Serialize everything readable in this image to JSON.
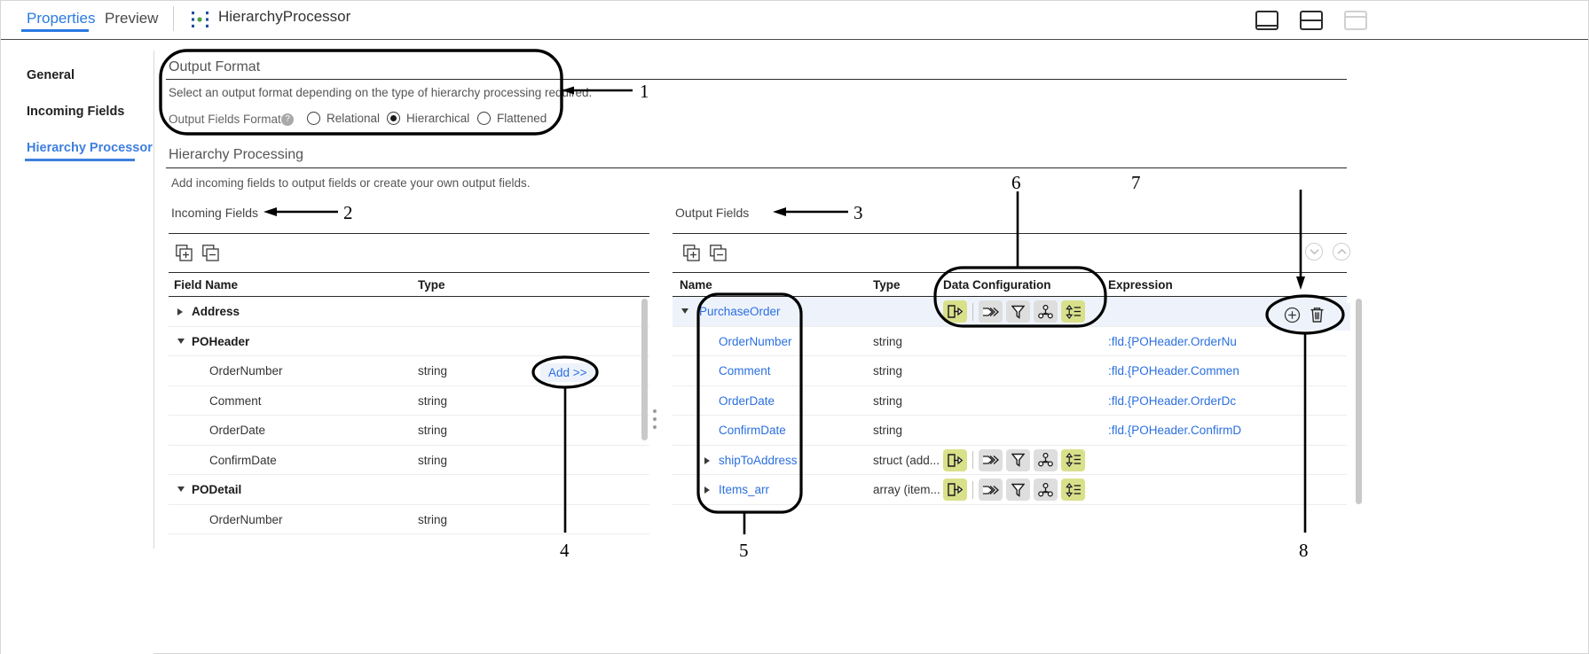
{
  "window": {
    "tabs": [
      {
        "label": "Properties",
        "active": true
      },
      {
        "label": "Preview",
        "active": false
      }
    ],
    "processor_title": "HierarchyProcessor",
    "processor_icon": "hierarchy-processor-icon",
    "layout_buttons": [
      {
        "icon": "layout-bottom-panel-icon",
        "state": "enabled"
      },
      {
        "icon": "layout-split-horizontal-icon",
        "state": "enabled"
      },
      {
        "icon": "layout-single-panel-icon",
        "state": "disabled"
      }
    ]
  },
  "sidebar": {
    "items": [
      {
        "label": "General",
        "active": false
      },
      {
        "label": "Incoming Fields",
        "active": false
      },
      {
        "label": "Hierarchy Processor",
        "active": true
      }
    ]
  },
  "output_format": {
    "title": "Output Format",
    "description": "Select an output format depending on the type of hierarchy processing required.",
    "field_label": "Output Fields Format:",
    "required_marker": "*",
    "help_icon": "help-icon",
    "help_glyph": "?",
    "options": [
      {
        "label": "Relational",
        "selected": false
      },
      {
        "label": "Hierarchical",
        "selected": true
      },
      {
        "label": "Flattened",
        "selected": false
      }
    ]
  },
  "hierarchy_processing": {
    "title": "Hierarchy Processing",
    "description": "Add incoming fields to output fields or create your own output fields."
  },
  "incoming_fields": {
    "panel_label": "Incoming Fields",
    "toolbar": [
      {
        "icon": "expand-all-icon",
        "label": "Expand All"
      },
      {
        "icon": "collapse-all-icon",
        "label": "Collapse All"
      }
    ],
    "columns": [
      "Field Name",
      "Type"
    ],
    "add_button_label": "Add >>",
    "rows": [
      {
        "name": "Address",
        "type": "",
        "level": 0,
        "group": true,
        "caret": "right"
      },
      {
        "name": "POHeader",
        "type": "",
        "level": 0,
        "group": true,
        "caret": "down"
      },
      {
        "name": "OrderNumber",
        "type": "string",
        "level": 1,
        "group": false,
        "caret": "none"
      },
      {
        "name": "Comment",
        "type": "string",
        "level": 1,
        "group": false,
        "caret": "none"
      },
      {
        "name": "OrderDate",
        "type": "string",
        "level": 1,
        "group": false,
        "caret": "none"
      },
      {
        "name": "ConfirmDate",
        "type": "string",
        "level": 1,
        "group": false,
        "caret": "none"
      },
      {
        "name": "PODetail",
        "type": "",
        "level": 0,
        "group": true,
        "caret": "down"
      },
      {
        "name": "OrderNumber",
        "type": "string",
        "level": 1,
        "group": false,
        "caret": "none"
      }
    ]
  },
  "output_fields": {
    "panel_label": "Output Fields",
    "toolbar": [
      {
        "icon": "expand-all-icon",
        "label": "Expand All"
      },
      {
        "icon": "collapse-all-icon",
        "label": "Collapse All"
      }
    ],
    "sort_buttons": [
      {
        "icon": "chevron-down-circle-icon"
      },
      {
        "icon": "chevron-up-circle-icon"
      }
    ],
    "columns": [
      "Name",
      "Type",
      "Data Configuration",
      "Expression"
    ],
    "row_actions": [
      {
        "icon": "add-field-icon",
        "label": "Add"
      },
      {
        "icon": "trash-icon",
        "label": "Delete"
      }
    ],
    "data_config_icons": [
      {
        "icon": "output-field-icon",
        "state": "on"
      },
      {
        "icon": "join-icon",
        "state": "off"
      },
      {
        "icon": "filter-icon",
        "state": "off"
      },
      {
        "icon": "group-by-icon",
        "state": "off"
      },
      {
        "icon": "sort-icon",
        "state": "on"
      }
    ],
    "rows": [
      {
        "name": "PurchaseOrder",
        "type": "",
        "expression": "",
        "level": 0,
        "caret": "down",
        "has_config": true,
        "selected": true
      },
      {
        "name": "OrderNumber",
        "type": "string",
        "expression": ":fld.{POHeader.OrderNu",
        "level": 1,
        "caret": "none",
        "has_config": false,
        "selected": false
      },
      {
        "name": "Comment",
        "type": "string",
        "expression": ":fld.{POHeader.Commen",
        "level": 1,
        "caret": "none",
        "has_config": false,
        "selected": false
      },
      {
        "name": "OrderDate",
        "type": "string",
        "expression": ":fld.{POHeader.OrderDc",
        "level": 1,
        "caret": "none",
        "has_config": false,
        "selected": false
      },
      {
        "name": "ConfirmDate",
        "type": "string",
        "expression": ":fld.{POHeader.ConfirmD",
        "level": 1,
        "caret": "none",
        "has_config": false,
        "selected": false
      },
      {
        "name": "shipToAddress",
        "type": "struct (add...",
        "expression": "",
        "level": 1,
        "caret": "right",
        "has_config": true,
        "selected": false
      },
      {
        "name": "Items_arr",
        "type": "array (item...",
        "expression": "",
        "level": 1,
        "caret": "right",
        "has_config": true,
        "selected": false
      }
    ]
  },
  "annotations": [
    {
      "number": "1"
    },
    {
      "number": "2"
    },
    {
      "number": "3"
    },
    {
      "number": "4"
    },
    {
      "number": "5"
    },
    {
      "number": "6"
    },
    {
      "number": "7"
    },
    {
      "number": "8"
    }
  ],
  "colors": {
    "accent": "#2a7ae2",
    "link": "#2a6fe0",
    "icon_active_bg": "#d9e08a",
    "icon_inactive_bg": "#dedede",
    "required": "#e03b3b",
    "selected_row_bg": "#eef3fb"
  }
}
